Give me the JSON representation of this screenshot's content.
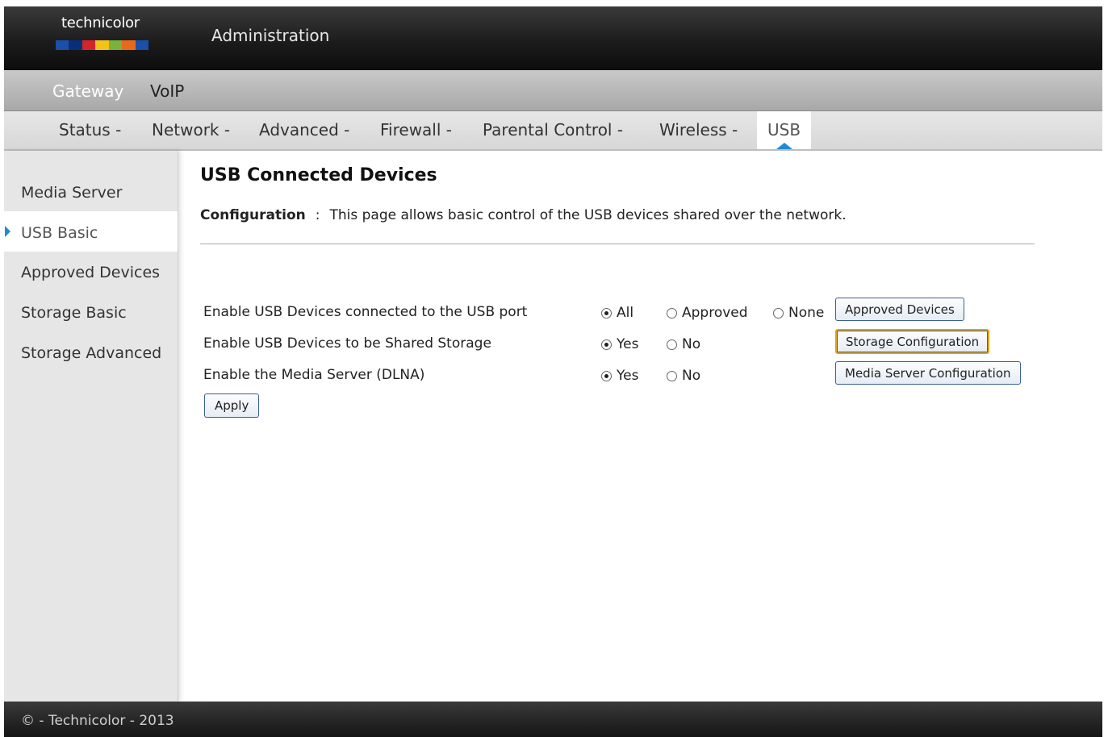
{
  "brand": {
    "logo_text": "technicolor",
    "section_title": "Administration",
    "logo_colors": [
      "#1b4fa8",
      "#0a2f7a",
      "#d3262b",
      "#f0c419",
      "#7bb13c",
      "#e76a1b",
      "#1b4fa8"
    ]
  },
  "menu": {
    "items": [
      "Gateway",
      "VoIP"
    ]
  },
  "subnav": {
    "items": [
      "Status -",
      "Network -",
      "Advanced -",
      "Firewall -",
      "Parental Control -",
      "Wireless -",
      "USB"
    ],
    "active": "USB"
  },
  "sidebar": {
    "items": [
      "Media Server",
      "USB Basic",
      "Approved Devices",
      "Storage Basic",
      "Storage Advanced"
    ],
    "active": "USB Basic"
  },
  "main": {
    "title": "USB Connected Devices",
    "config_label": "Configuration",
    "config_sep": ":",
    "config_text": "This page allows basic control of the USB devices shared over the network.",
    "rows": [
      {
        "label": "Enable USB Devices connected to the USB port",
        "options": [
          "All",
          "Approved",
          "None"
        ],
        "selected": "All",
        "button": "Approved Devices"
      },
      {
        "label": "Enable USB Devices to be Shared Storage",
        "options": [
          "Yes",
          "No"
        ],
        "selected": "Yes",
        "button": "Storage Configuration"
      },
      {
        "label": "Enable the Media Server (DLNA)",
        "options": [
          "Yes",
          "No"
        ],
        "selected": "Yes",
        "button": "Media Server Configuration"
      }
    ],
    "apply_label": "Apply"
  },
  "footer": {
    "text": "© - Technicolor - 2013"
  },
  "colors": {
    "accent": "#1f8ad6",
    "header_dark": "#1a1a1a",
    "sidebar_bg": "#e6e6e6"
  }
}
